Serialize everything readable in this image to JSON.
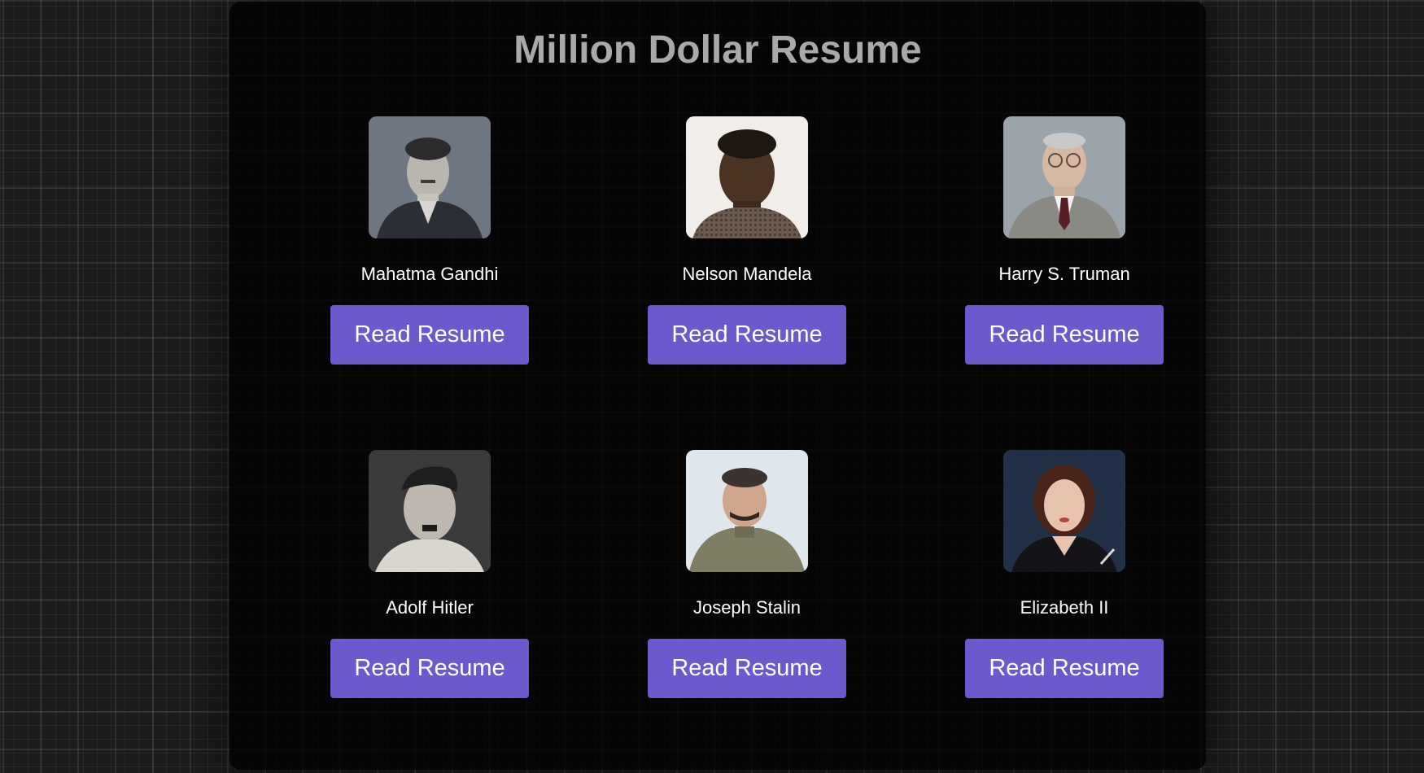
{
  "page": {
    "title": "Million Dollar Resume"
  },
  "colors": {
    "button_bg": "#6a5acd",
    "title": "#a9a9a9",
    "name_text": "#ffffff",
    "panel_bg": "#000000"
  },
  "people": [
    {
      "name": "Mahatma Gandhi",
      "button_label": "Read Resume",
      "portrait": "portrait-gandhi"
    },
    {
      "name": "Nelson Mandela",
      "button_label": "Read Resume",
      "portrait": "portrait-mandela"
    },
    {
      "name": "Harry S. Truman",
      "button_label": "Read Resume",
      "portrait": "portrait-truman"
    },
    {
      "name": "Adolf Hitler",
      "button_label": "Read Resume",
      "portrait": "portrait-hitler"
    },
    {
      "name": "Joseph Stalin",
      "button_label": "Read Resume",
      "portrait": "portrait-stalin"
    },
    {
      "name": "Elizabeth II",
      "button_label": "Read Resume",
      "portrait": "portrait-elizabeth"
    }
  ]
}
